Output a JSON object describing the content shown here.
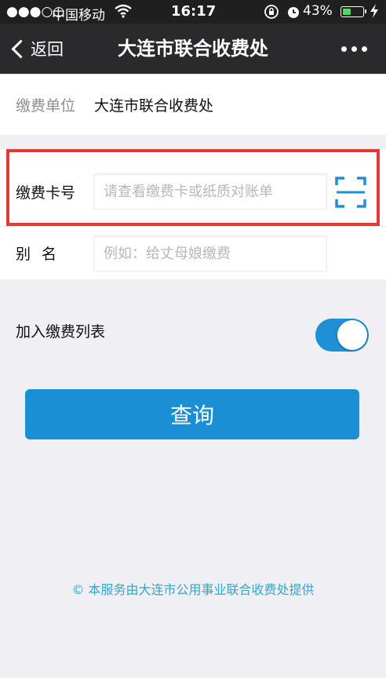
{
  "status_bar": {
    "signal": "●●●○○",
    "carrier": "中国移动",
    "time": "16:17",
    "battery_pct": "43%",
    "battery_level": 0.43,
    "battery_color": "#4cd964",
    "icons": [
      "signal-icon",
      "wifi-icon",
      "orientation-lock-icon",
      "alarm-icon",
      "battery-icon",
      "charging-icon"
    ]
  },
  "navbar": {
    "back_label": "返回",
    "title": "大连市联合收费处",
    "more_icon": "more-dots-icon"
  },
  "form": {
    "unit_label": "缴费单位",
    "unit_value": "大连市联合收费处",
    "card_label": "缴费卡号",
    "card_placeholder": "请查看缴费卡或纸质对账单",
    "card_value": "",
    "scan_icon": "scan-icon",
    "alias_label": "别名",
    "alias_placeholder": "例如：给丈母娘缴费",
    "alias_value": ""
  },
  "toggle": {
    "label": "加入缴费列表",
    "on": true,
    "color": "#1f8fd6"
  },
  "query_button": {
    "label": "查询",
    "color": "#1a8fd3"
  },
  "highlight_color": "#e53935",
  "footer": {
    "text": "© 本服务由大连市公用事业联合收费处提供"
  }
}
